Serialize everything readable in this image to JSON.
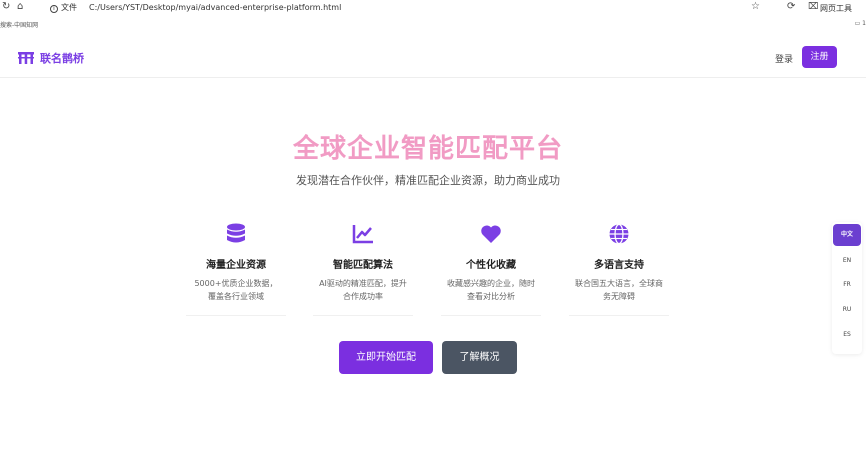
{
  "browser": {
    "file_label": "文件",
    "url": "C:/Users/YST/Desktop/myai/advanced-enterprise-platform.html",
    "menu_label": "网页工具",
    "bookmark": "搜索-中国知网"
  },
  "nav": {
    "brand": "联名鹊桥",
    "login": "登录",
    "register": "注册"
  },
  "hero": {
    "title": "全球企业智能匹配平台",
    "subtitle": "发现潜在合作伙伴，精准匹配企业资源，助力商业成功"
  },
  "features": [
    {
      "icon": "database-icon",
      "title": "海量企业资源",
      "desc": "5000+优质企业数据，覆盖各行业领域"
    },
    {
      "icon": "chart-line-icon",
      "title": "智能匹配算法",
      "desc": "AI驱动的精准匹配，提升合作成功率"
    },
    {
      "icon": "heart-icon",
      "title": "个性化收藏",
      "desc": "收藏感兴趣的企业，随时查看对比分析"
    },
    {
      "icon": "globe-icon",
      "title": "多语言支持",
      "desc": "联合国五大语言，全球商务无障碍"
    }
  ],
  "actions": {
    "start": "立即开始匹配",
    "overview": "了解概况"
  },
  "languages": [
    "中文",
    "EN",
    "FR",
    "RU",
    "ES"
  ],
  "colors": {
    "accent": "#7b2fe0",
    "title_pink": "#f19bc4",
    "secondary_button": "#4b5563",
    "lang_active": "#6b3fd0"
  }
}
